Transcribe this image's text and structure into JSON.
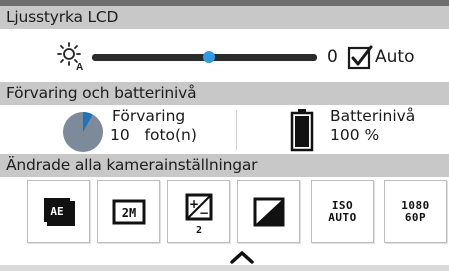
{
  "sections": {
    "lcd_brightness": {
      "title": "Ljusstyrka LCD"
    },
    "storage_battery": {
      "title": "Förvaring och batterinivå"
    },
    "changed_settings": {
      "title": "Ändrade alla kamerainställningar"
    }
  },
  "brightness": {
    "icon": "sun-auto-icon",
    "value_text": "0",
    "level_fraction": 0.52,
    "auto_checked": true,
    "auto_label": "Auto"
  },
  "storage": {
    "icon": "storage-pie-icon",
    "label": "Förvaring",
    "count_text": "10   foto(n)",
    "used_fraction": 0.08
  },
  "battery": {
    "icon": "battery-full-icon",
    "label": "Batterinivå",
    "value_text": "100 %",
    "level_fraction": 1.0
  },
  "settings_icons": [
    {
      "name": "ae-metering-icon",
      "text": ""
    },
    {
      "name": "image-size-2m-icon",
      "text": ""
    },
    {
      "name": "exposure-compensation-icon",
      "text": ""
    },
    {
      "name": "contrast-icon",
      "text": ""
    },
    {
      "name": "iso-auto-icon",
      "text": "ISO\nAUTO"
    },
    {
      "name": "video-1080-60p-icon",
      "text": "1080\n60P"
    }
  ],
  "colors": {
    "header_bg": "#c8c8c8",
    "accent_blue": "#2f9be0",
    "pie_used": "#1e73be",
    "pie_free": "#7c8a9a"
  },
  "expand_icon": "chevron-up-icon"
}
